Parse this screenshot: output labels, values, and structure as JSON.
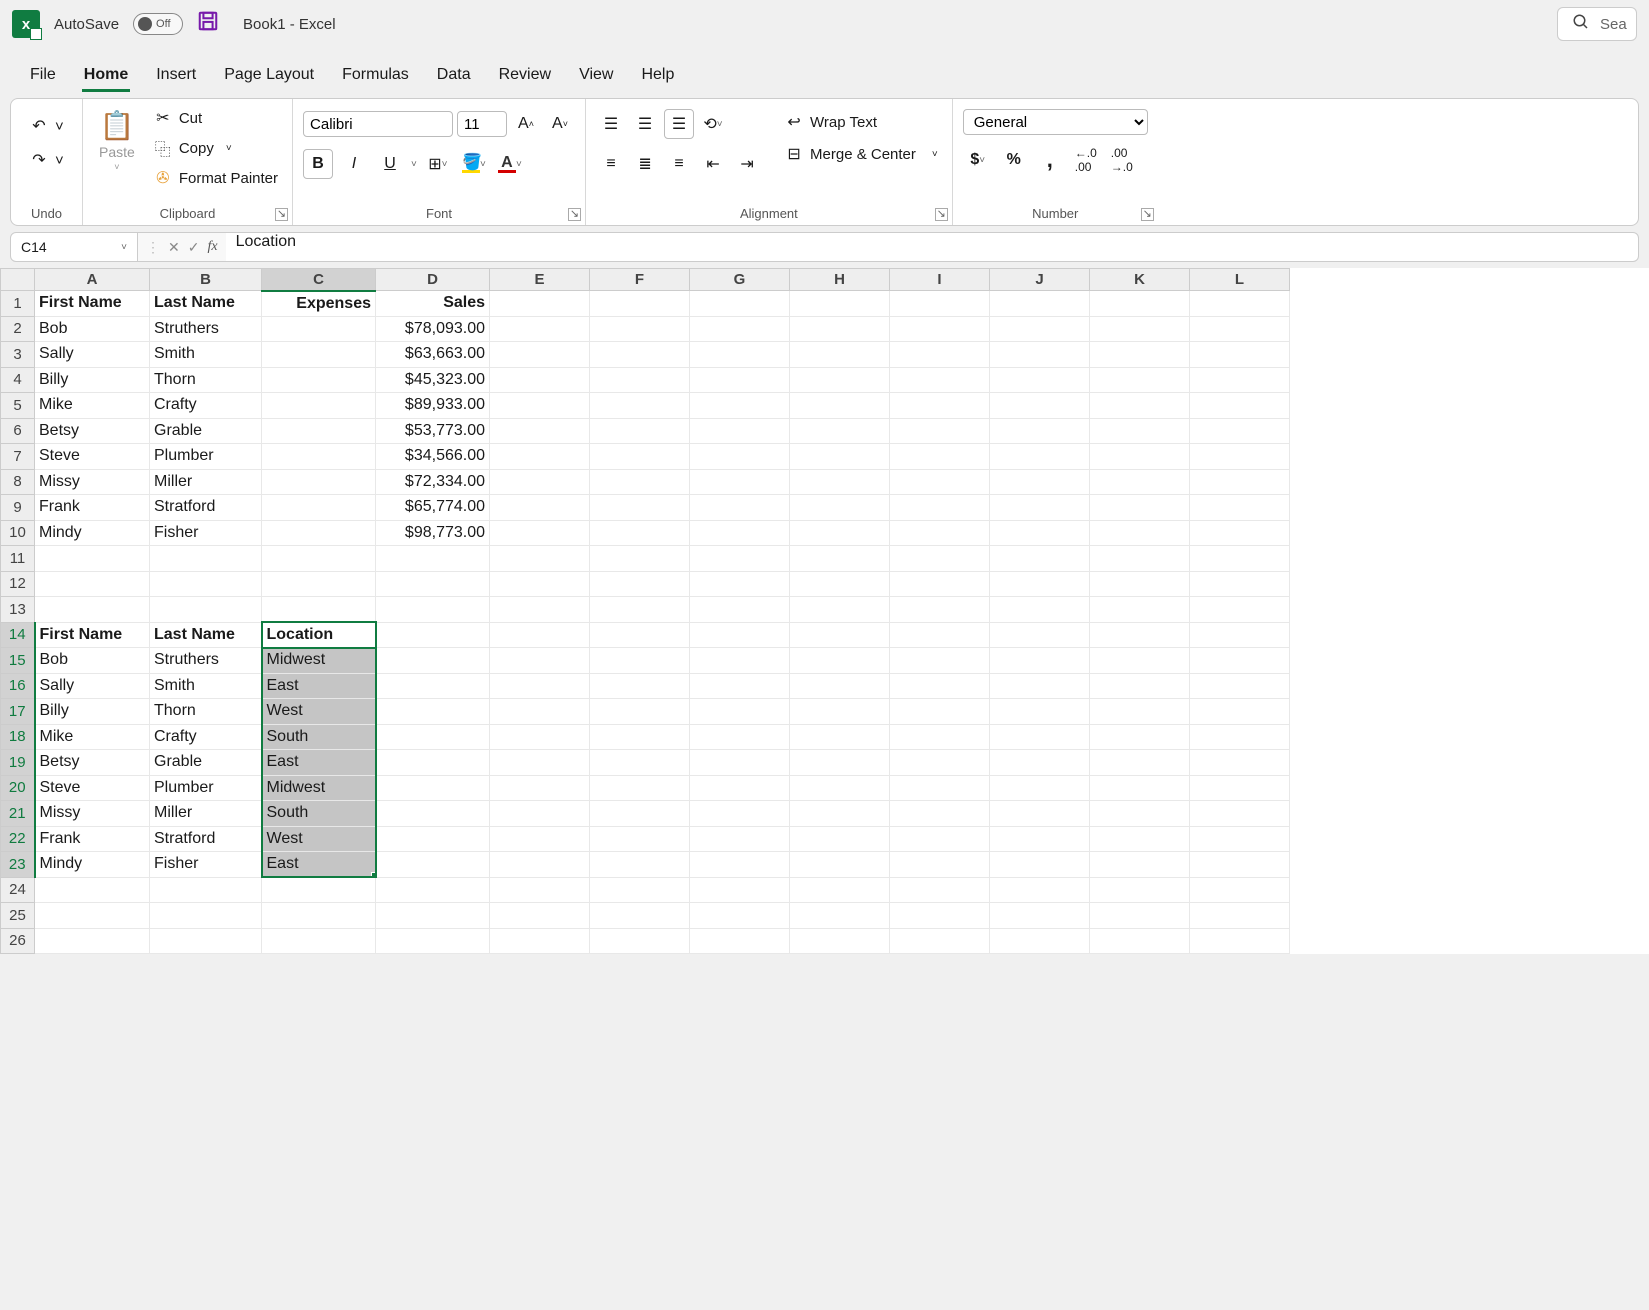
{
  "app": {
    "autosave_label": "AutoSave",
    "autosave_state": "Off",
    "title": "Book1 - Excel",
    "search_placeholder": "Sea"
  },
  "tabs": {
    "file": "File",
    "home": "Home",
    "insert": "Insert",
    "page_layout": "Page Layout",
    "formulas": "Formulas",
    "data": "Data",
    "review": "Review",
    "view": "View",
    "help": "Help"
  },
  "ribbon": {
    "undo": {
      "label": "Undo"
    },
    "clipboard": {
      "label": "Clipboard",
      "paste": "Paste",
      "cut": "Cut",
      "copy": "Copy",
      "format_painter": "Format Painter"
    },
    "font": {
      "label": "Font",
      "name": "Calibri",
      "size": "11"
    },
    "alignment": {
      "label": "Alignment",
      "wrap": "Wrap Text",
      "merge": "Merge & Center"
    },
    "number": {
      "label": "Number",
      "format": "General"
    }
  },
  "formula_bar": {
    "name_box": "C14",
    "formula": "Location"
  },
  "columns": [
    "A",
    "B",
    "C",
    "D",
    "E",
    "F",
    "G",
    "H",
    "I",
    "J",
    "K",
    "L"
  ],
  "grid": {
    "headers1": {
      "A": "First Name",
      "B": "Last Name",
      "C": "Expenses",
      "D": "Sales"
    },
    "data1": [
      {
        "A": "Bob",
        "B": "Struthers",
        "C": "",
        "D": "$78,093.00"
      },
      {
        "A": "Sally",
        "B": "Smith",
        "C": "",
        "D": "$63,663.00"
      },
      {
        "A": "Billy",
        "B": "Thorn",
        "C": "",
        "D": "$45,323.00"
      },
      {
        "A": "Mike",
        "B": "Crafty",
        "C": "",
        "D": "$89,933.00"
      },
      {
        "A": "Betsy",
        "B": "Grable",
        "C": "",
        "D": "$53,773.00"
      },
      {
        "A": "Steve",
        "B": "Plumber",
        "C": "",
        "D": "$34,566.00"
      },
      {
        "A": "Missy",
        "B": "Miller",
        "C": "",
        "D": "$72,334.00"
      },
      {
        "A": "Frank",
        "B": "Stratford",
        "C": "",
        "D": "$65,774.00"
      },
      {
        "A": "Mindy",
        "B": "Fisher",
        "C": "",
        "D": "$98,773.00"
      }
    ],
    "headers2": {
      "A": "First Name",
      "B": "Last Name",
      "C": "Location"
    },
    "data2": [
      {
        "A": "Bob",
        "B": "Struthers",
        "C": "Midwest"
      },
      {
        "A": "Sally",
        "B": "Smith",
        "C": "East"
      },
      {
        "A": "Billy",
        "B": "Thorn",
        "C": "West"
      },
      {
        "A": "Mike",
        "B": "Crafty",
        "C": "South"
      },
      {
        "A": "Betsy",
        "B": "Grable",
        "C": "East"
      },
      {
        "A": "Steve",
        "B": "Plumber",
        "C": "Midwest"
      },
      {
        "A": "Missy",
        "B": "Miller",
        "C": "South"
      },
      {
        "A": "Frank",
        "B": "Stratford",
        "C": "West"
      },
      {
        "A": "Mindy",
        "B": "Fisher",
        "C": "East"
      }
    ],
    "selection": {
      "active": "C14",
      "range_start_row": 14,
      "range_end_row": 23,
      "col": "C"
    }
  }
}
